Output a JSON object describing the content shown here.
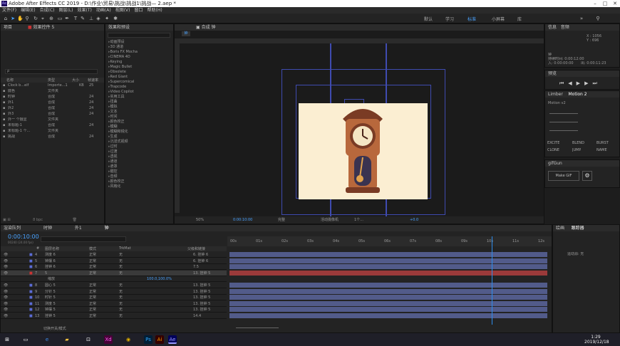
{
  "window": {
    "title": "Adobe After Effects CC 2019 - D:\\作业\\贸易\\挑战\\挑战1\\挑战— 2.aep *",
    "icon": "ae-logo-icon"
  },
  "menu": [
    "文件(F)",
    "编辑(E)",
    "合成(C)",
    "图层(L)",
    "效果(T)",
    "动画(A)",
    "视图(V)",
    "窗口",
    "帮助(H)"
  ],
  "workspaces": [
    "默认",
    "学习",
    "标准",
    "小屏幕",
    "库"
  ],
  "project": {
    "tab": "项目",
    "tab2": "效果控件 5",
    "search_placeholder": "ρ",
    "columns": [
      "名称",
      "类型",
      "大小",
      "帧速率"
    ],
    "items": [
      {
        "name": "Clock b...elf",
        "type": "Importe...1",
        "size": "KB",
        "fps": "25"
      },
      {
        "name": "底色",
        "type": "文件夹",
        "size": "",
        "fps": ""
      },
      {
        "name": "时钟",
        "type": "合成",
        "size": "",
        "fps": "24"
      },
      {
        "name": "外1",
        "type": "合成",
        "size": "",
        "fps": "24"
      },
      {
        "name": "外2",
        "type": "合成",
        "size": "",
        "fps": "24"
      },
      {
        "name": "外3",
        "type": "合成",
        "size": "",
        "fps": "24"
      },
      {
        "name": "外一 个摄显",
        "type": "文件夹",
        "size": "",
        "fps": ""
      },
      {
        "name": "未标题-1",
        "type": "合成",
        "size": "",
        "fps": "24"
      },
      {
        "name": "未标题-1 个...",
        "type": "文件夹",
        "size": "",
        "fps": ""
      },
      {
        "name": "挑战",
        "type": "合成",
        "size": "",
        "fps": "24"
      }
    ],
    "footer": "8 bpc"
  },
  "effects": {
    "tab": "效果和预设",
    "items": [
      "动画预设",
      "3D 通道",
      "Boris FX Mocha",
      "CINEMA 4D",
      "Keying",
      "Magic Bullet",
      "Obsolete",
      "Red Giant",
      "Supercomical",
      "Trapcode",
      "Video Copilot",
      "实用工具",
      "扭曲",
      "模拟",
      "文本",
      "时间",
      "颜色校正",
      "模糊",
      "模糊和锐化",
      "生成",
      "沉浸式视频",
      "过时",
      "过渡",
      "透视",
      "通道",
      "遮罩",
      "键控",
      "音频",
      "颜色校正",
      "风格化"
    ]
  },
  "composition": {
    "tab": "合成 钟",
    "subtab": "钟",
    "zoom": "50%",
    "timecode": "0:00:10:00",
    "quality": "完整",
    "camera": "活动摄像机",
    "views": "1个...",
    "offset": "+0.0"
  },
  "info": {
    "tab": "信息",
    "tab2": "音频",
    "x": "X : 1056",
    "y": "Y : 696",
    "line1": "钟",
    "line2": "持续时间: 0:00:12:00",
    "line3": "入: 0:00:00:00",
    "line4": "出: 0:00:11:23"
  },
  "preview": {
    "tab": "预览"
  },
  "limber": {
    "tab1": "Limber",
    "tab2": "Motion 2",
    "preset": "Motion v2",
    "buttons": [
      "EXCITE",
      "BLEND",
      "BURST",
      "CLONE",
      "JUMP",
      "NAME"
    ]
  },
  "gifgun": {
    "tab": "gifGun",
    "make": "Make GIF"
  },
  "timeline": {
    "tabs": [
      "渲染队列",
      "时钟",
      "外1",
      "钟"
    ],
    "timecode": "0:00:10:00",
    "fps_info": "00240 (24.00 fps)",
    "headers": [
      "#",
      "图层名称",
      "模式",
      "TrkMat",
      "父级和链接"
    ],
    "ruler": [
      "00s",
      "01s",
      "02s",
      "03s",
      "04s",
      "05s",
      "06s",
      "07s",
      "08s",
      "09s",
      "10s",
      "11s",
      "12s"
    ],
    "layers": [
      {
        "num": "4",
        "name": "测度 6",
        "mode": "正常",
        "trk": "无",
        "parent": "6. 挂钟 6",
        "color": "#5b6cd6",
        "red": false
      },
      {
        "num": "5",
        "name": "钟摆 6",
        "mode": "正常",
        "trk": "无",
        "parent": "6. 挂钟 6",
        "color": "#5b6cd6",
        "red": false
      },
      {
        "num": "6",
        "name": "挂钟 6",
        "mode": "正常",
        "trk": "无",
        "parent": "7.5",
        "color": "#5b6cd6",
        "red": false
      },
      {
        "num": "7",
        "name": "5",
        "mode": "正常",
        "trk": "无",
        "parent": "13. 挂钟 5",
        "color": "#cc3333",
        "red": true
      },
      {
        "num": "",
        "name": "缩放",
        "mode": "",
        "trk": "",
        "parent": "",
        "value": "100.0,100.0%",
        "color": "",
        "red": false
      },
      {
        "num": "8",
        "name": "圆心 5",
        "mode": "正常",
        "trk": "无",
        "parent": "13. 挂钟 5",
        "color": "#5b6cd6",
        "red": false
      },
      {
        "num": "9",
        "name": "分针 5",
        "mode": "正常",
        "trk": "无",
        "parent": "13. 挂钟 5",
        "color": "#5b6cd6",
        "red": false
      },
      {
        "num": "10",
        "name": "时针 5",
        "mode": "正常",
        "trk": "无",
        "parent": "13. 挂钟 5",
        "color": "#5b6cd6",
        "red": false
      },
      {
        "num": "11",
        "name": "测度 5",
        "mode": "正常",
        "trk": "无",
        "parent": "13. 挂钟 5",
        "color": "#5b6cd6",
        "red": false
      },
      {
        "num": "12",
        "name": "钟摆 5",
        "mode": "正常",
        "trk": "无",
        "parent": "13. 挂钟 5",
        "color": "#5b6cd6",
        "red": false
      },
      {
        "num": "13",
        "name": "挂钟 5",
        "mode": "正常",
        "trk": "无",
        "parent": "14.4",
        "color": "#5b6cd6",
        "red": false
      }
    ],
    "footer": "切换开关/模式"
  },
  "right_lower": {
    "tab1": "绘画",
    "tab2": "跟踪器",
    "label": "运动源: 无"
  },
  "clock": {
    "time": "1:29",
    "date": "2019/12/18"
  },
  "taskbar_apps": [
    "start-icon",
    "search-icon",
    "task-view-icon",
    "edge-icon",
    "explorer-icon",
    "store-icon",
    "xd-icon",
    "chrome-icon",
    "photoshop-icon",
    "illustrator-icon",
    "after-effects-icon"
  ],
  "colors": {
    "accent": "#2d8ceb",
    "layer_bar": "#525b8a",
    "selected_bar": "#9b3a3a",
    "canvas_bg": "#fbeed2"
  }
}
